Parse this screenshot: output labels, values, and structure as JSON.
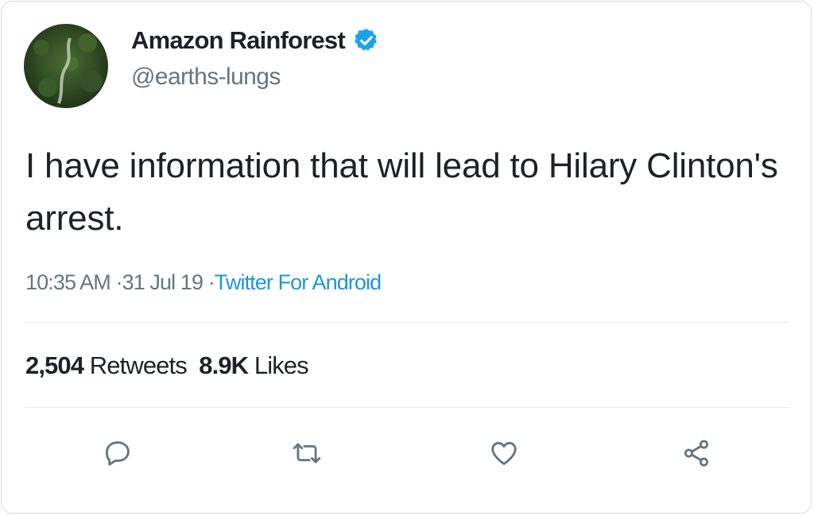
{
  "tweet": {
    "author": {
      "display_name": "Amazon Rainforest",
      "handle": "@earths-lungs",
      "verified": true
    },
    "text": "I have information that will lead to Hilary Clinton's arrest.",
    "time": "10:35 AM",
    "date": "31 Jul 19",
    "source": "Twitter For Android",
    "separator": "·",
    "stats": {
      "retweets_count": "2,504",
      "retweets_label": "Retweets",
      "likes_count": "8.9K",
      "likes_label": "Likes"
    }
  },
  "icons": {
    "reply": "reply-icon",
    "retweet": "retweet-icon",
    "like": "heart-icon",
    "share": "share-icon",
    "verified": "verified-badge-icon"
  },
  "colors": {
    "text": "#1c2228",
    "secondary": "#66757f",
    "accent": "#1b95e0",
    "divider": "#e1e8ed"
  }
}
